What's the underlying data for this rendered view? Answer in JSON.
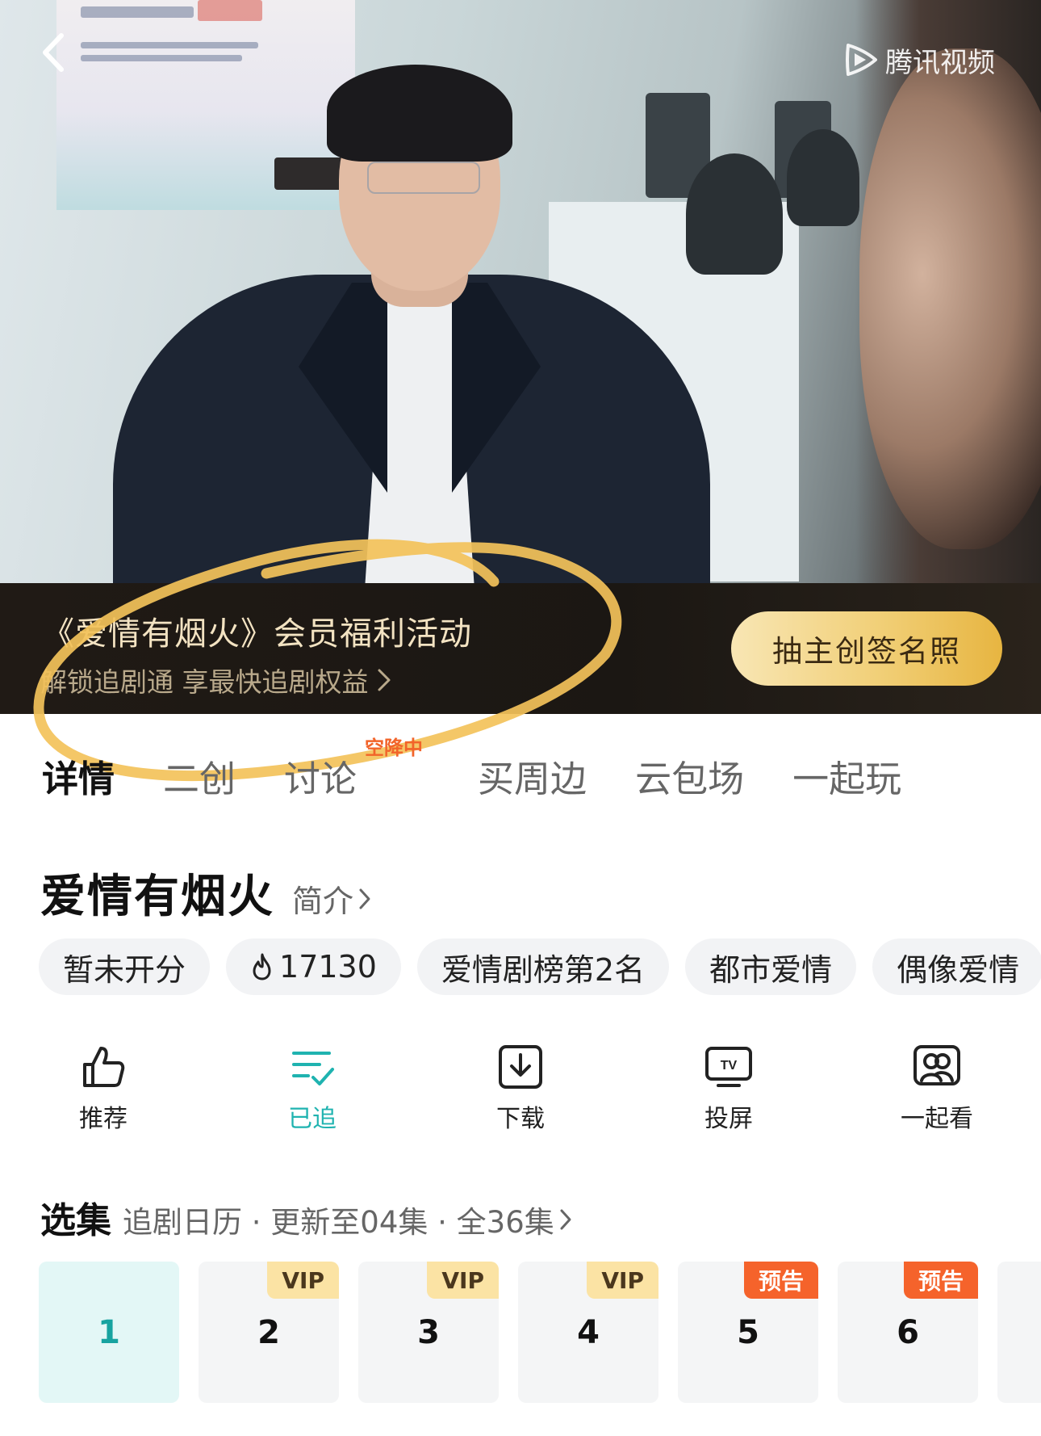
{
  "player": {
    "brand_name": "腾讯视频"
  },
  "promo": {
    "title": "《爱情有烟火》会员福利活动",
    "subtitle": "解锁追剧通 享最快追剧权益",
    "button_label": "抽主创签名照"
  },
  "tabs": [
    {
      "label": "详情",
      "active": true
    },
    {
      "label": "二创",
      "active": false
    },
    {
      "label": "讨论",
      "active": false,
      "badge": "空降中"
    },
    {
      "label": "买周边",
      "active": false
    },
    {
      "label": "云包场",
      "active": false
    },
    {
      "label": "一起玩",
      "active": false
    }
  ],
  "show": {
    "title": "爱情有烟火",
    "intro_label": "简介"
  },
  "tags": [
    "暂未开分",
    "17130",
    "爱情剧榜第2名",
    "都市爱情",
    "偶像爱情"
  ],
  "actions": [
    {
      "label": "推荐",
      "icon": "thumbs-up-icon"
    },
    {
      "label": "已追",
      "icon": "followed-list-icon",
      "active": true
    },
    {
      "label": "下载",
      "icon": "download-icon"
    },
    {
      "label": "投屏",
      "icon": "tv-cast-icon"
    },
    {
      "label": "一起看",
      "icon": "watch-together-icon"
    }
  ],
  "episodes": {
    "title": "选集",
    "meta": "追剧日历 · 更新至04集 · 全36集",
    "items": [
      {
        "number": "1",
        "badge": "",
        "active": true
      },
      {
        "number": "2",
        "badge": "VIP"
      },
      {
        "number": "3",
        "badge": "VIP"
      },
      {
        "number": "4",
        "badge": "VIP"
      },
      {
        "number": "5",
        "badge": "预告"
      },
      {
        "number": "6",
        "badge": "预告"
      }
    ]
  },
  "colors": {
    "accent_teal": "#1fb3b0",
    "vip_gold": "#fbe3a4",
    "preview_orange": "#f5632b",
    "annotation_yellow": "#f3c25a"
  }
}
